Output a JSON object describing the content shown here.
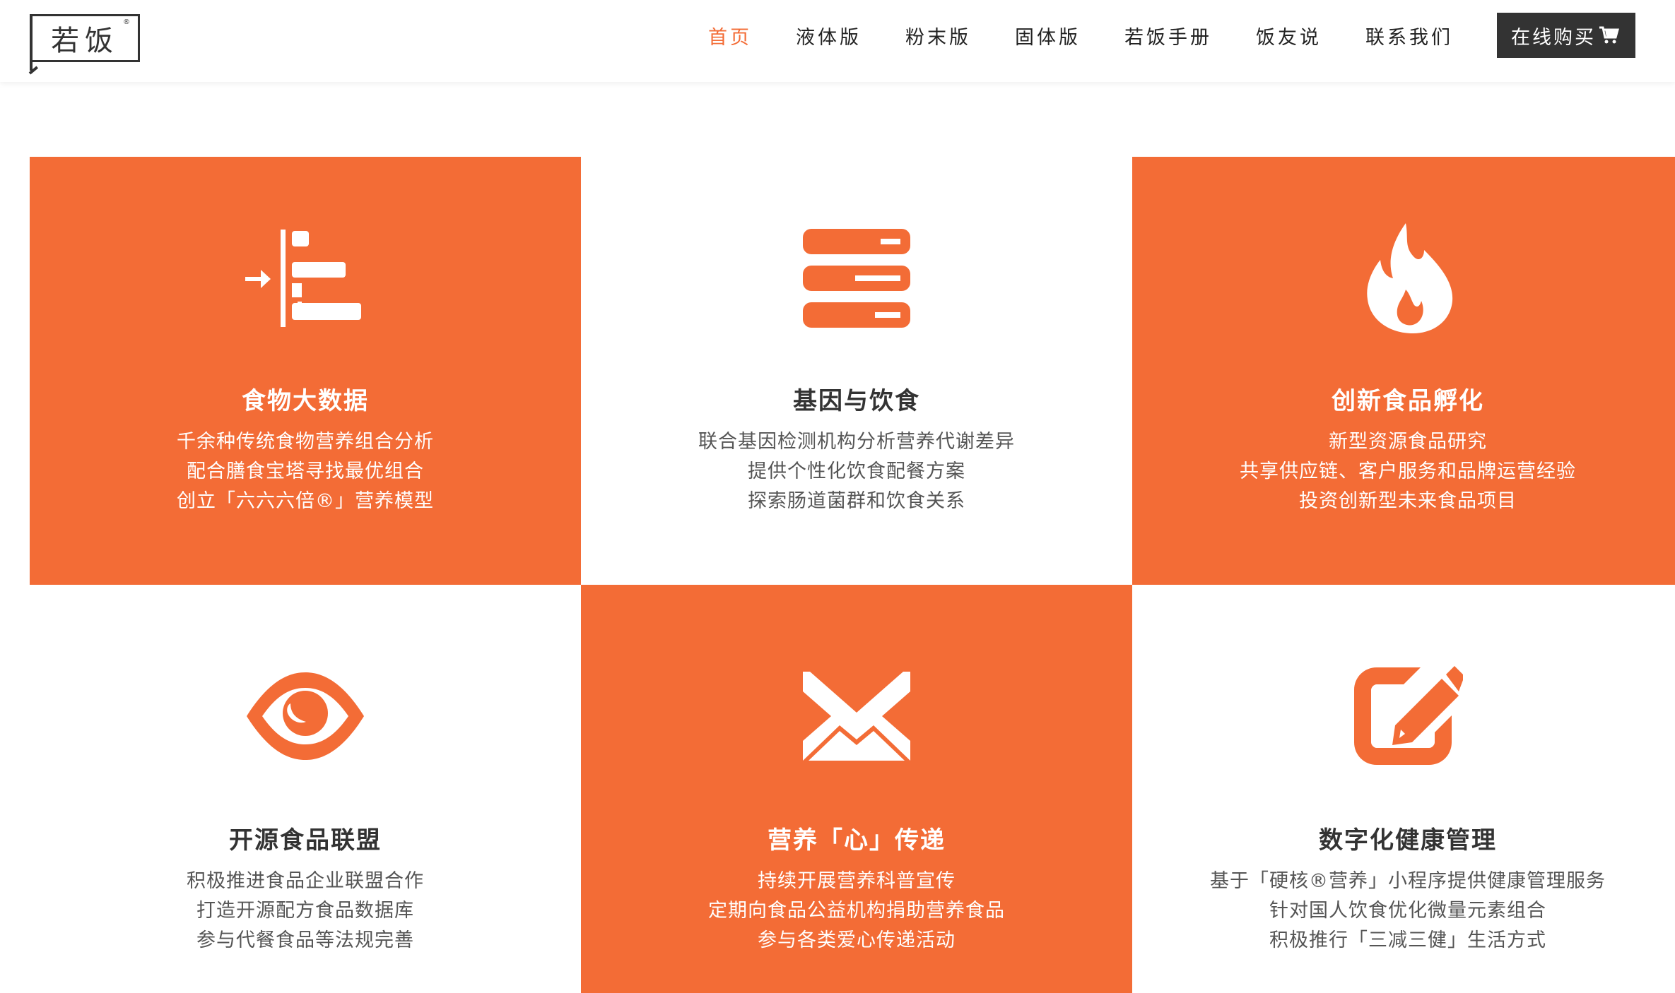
{
  "brand": {
    "logo_text": "若饭",
    "logo_mark": "®"
  },
  "nav": {
    "items": [
      "首页",
      "液体版",
      "粉末版",
      "固体版",
      "若饭手册",
      "饭友说",
      "联系我们"
    ],
    "active_index": 0,
    "buy_label": "在线购买"
  },
  "colors": {
    "accent": "#f36c36",
    "dark": "#333333",
    "white": "#ffffff"
  },
  "features": [
    {
      "icon": "indent-list-icon",
      "title": "食物大数据",
      "lines": [
        "千余种传统食物营养组合分析",
        "配合膳食宝塔寻找最优组合",
        "创立「六六六倍®」营养模型"
      ],
      "theme": "orange"
    },
    {
      "icon": "server-stack-icon",
      "title": "基因与饮食",
      "lines": [
        "联合基因检测机构分析营养代谢差异",
        "提供个性化饮食配餐方案",
        "探索肠道菌群和饮食关系"
      ],
      "theme": "white"
    },
    {
      "icon": "flame-icon",
      "title": "创新食品孵化",
      "lines": [
        "新型资源食品研究",
        "共享供应链、客户服务和品牌运营经验",
        "投资创新型未来食品项目"
      ],
      "theme": "orange"
    },
    {
      "icon": "eye-icon",
      "title": "开源食品联盟",
      "lines": [
        "积极推进食品企业联盟合作",
        "打造开源配方食品数据库",
        "参与代餐食品等法规完善"
      ],
      "theme": "white"
    },
    {
      "icon": "envelope-icon",
      "title": "营养「心」传递",
      "lines": [
        "持续开展营养科普宣传",
        "定期向食品公益机构捐助营养食品",
        "参与各类爱心传递活动"
      ],
      "theme": "orange"
    },
    {
      "icon": "edit-icon",
      "title": "数字化健康管理",
      "lines": [
        "基于「硬核®营养」小程序提供健康管理服务",
        "针对国人饮食优化微量元素组合",
        "积极推行「三减三健」生活方式"
      ],
      "theme": "white"
    }
  ]
}
